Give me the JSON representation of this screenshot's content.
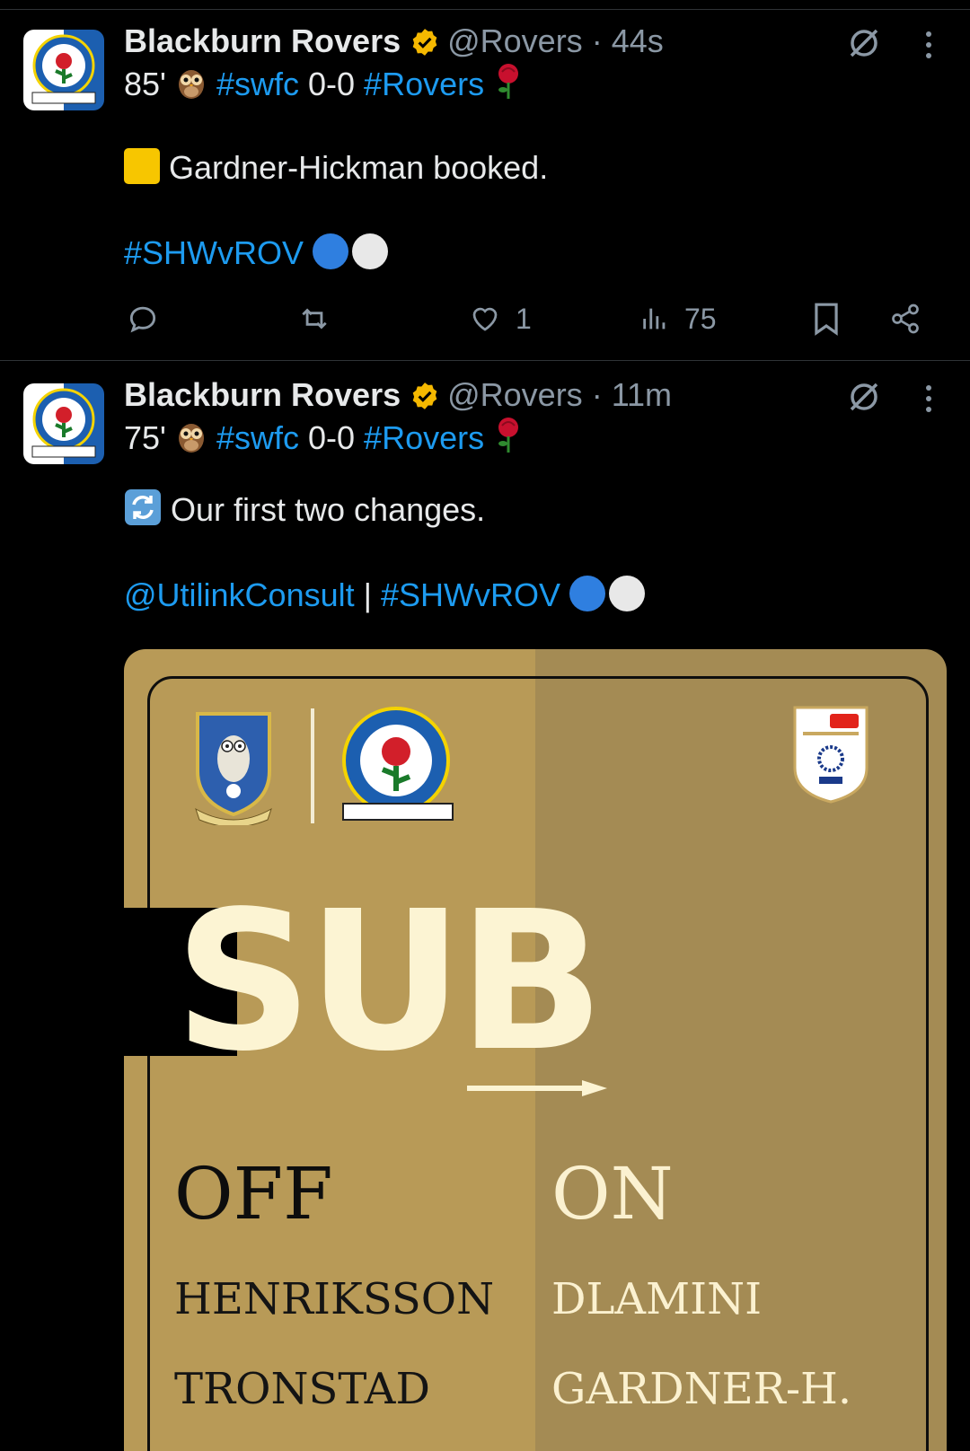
{
  "tweets": [
    {
      "author": {
        "name": "Blackburn Rovers",
        "handle": "@Rovers",
        "verified": true,
        "verified_color": "#f5b800"
      },
      "time": "44s",
      "score_line": {
        "minute": "85'",
        "hashtag_home": "#swfc",
        "score": "0-0",
        "hashtag_away": "#Rovers"
      },
      "body_line": "Gardner-Hickman booked.",
      "body_icon": "yellow-card",
      "footer_hashtag": "#SHWvROV",
      "stats": {
        "likes": "1",
        "views": "75"
      }
    },
    {
      "author": {
        "name": "Blackburn Rovers",
        "handle": "@Rovers",
        "verified": true,
        "verified_color": "#f5b800"
      },
      "time": "11m",
      "score_line": {
        "minute": "75'",
        "hashtag_home": "#swfc",
        "score": "0-0",
        "hashtag_away": "#Rovers"
      },
      "body_line": "Our first two changes.",
      "body_icon": "repeat-arrows",
      "mention": "@UtilinkConsult",
      "separator": "|",
      "footer_hashtag": "#SHWvROV",
      "media": {
        "headline": "SUB",
        "off_label": "OFF",
        "on_label": "ON",
        "off_players": [
          "HENRIKSSON",
          "TRONSTAD"
        ],
        "on_players": [
          "DLAMINI",
          "GARDNER-H."
        ],
        "colors": {
          "gold_left": "#b89a57",
          "gold_right": "#a48b54",
          "cream": "#fcf4d3"
        }
      }
    }
  ],
  "colors": {
    "link": "#1d9bf0",
    "muted": "#8b98a5",
    "text": "#e7e9ea",
    "background": "#000000"
  }
}
